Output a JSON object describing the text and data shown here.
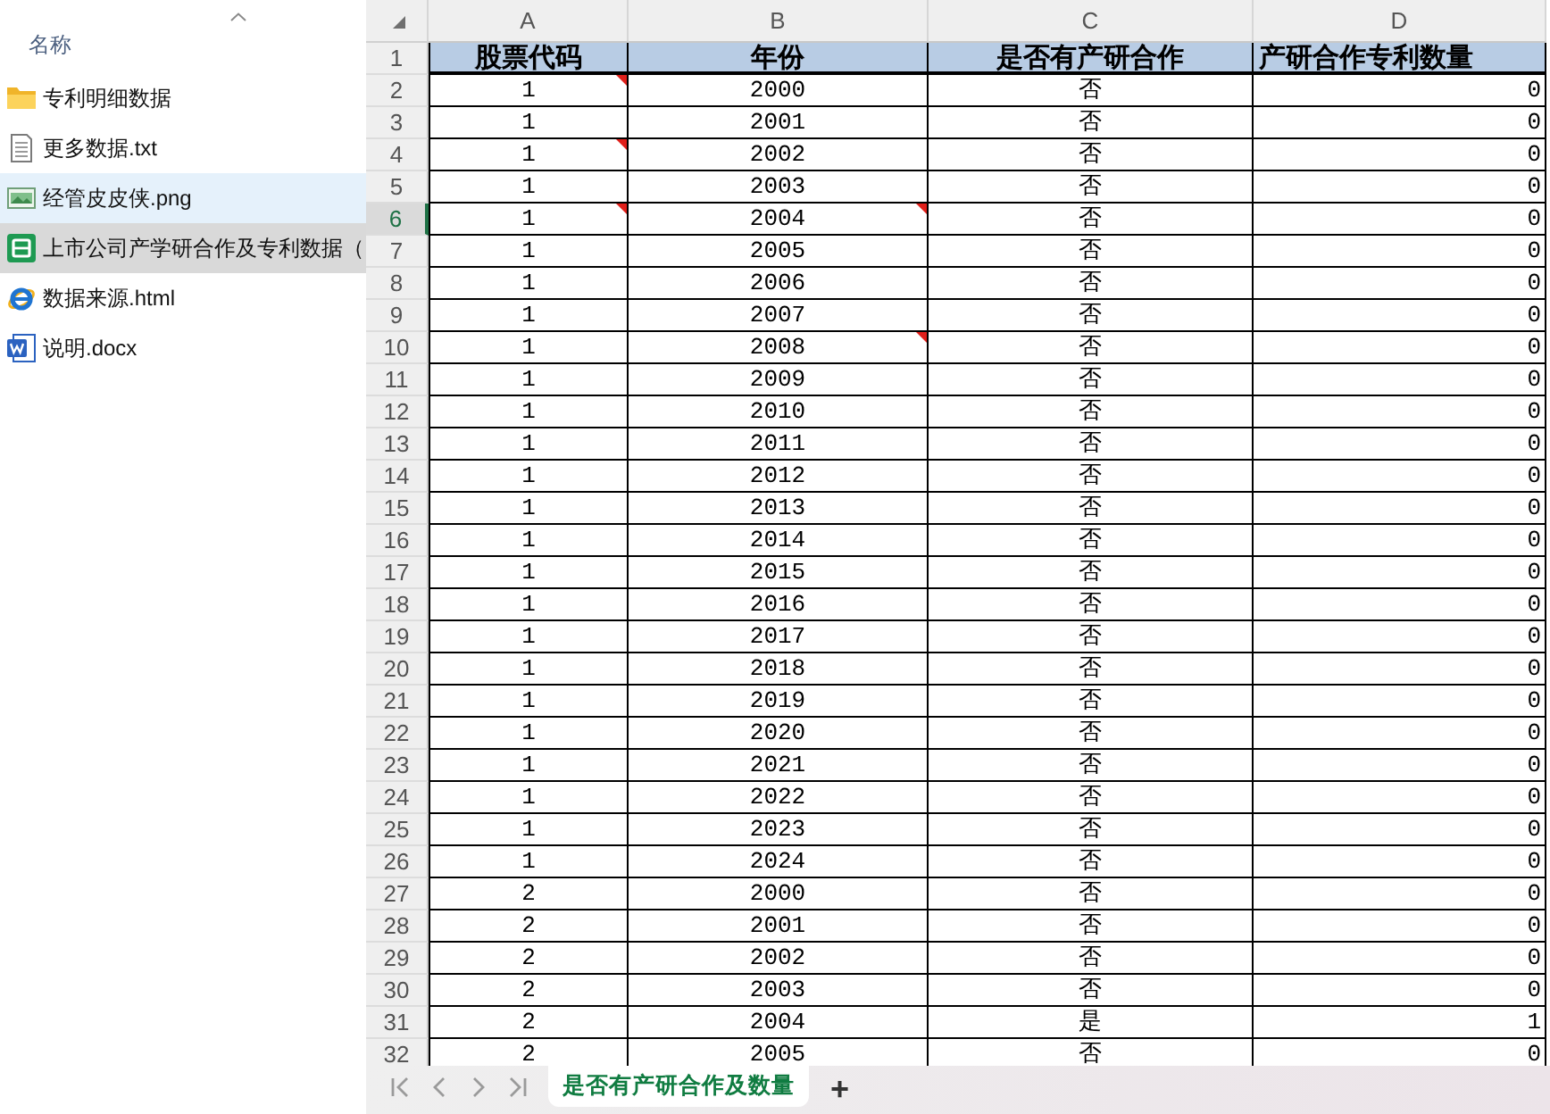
{
  "files_panel": {
    "column_header": "名称",
    "files": [
      {
        "name": "专利明细数据",
        "kind": "folder",
        "hovered": false,
        "selected": false
      },
      {
        "name": "更多数据.txt",
        "kind": "text",
        "hovered": false,
        "selected": false
      },
      {
        "name": "经管皮皮侠.png",
        "kind": "image",
        "hovered": true,
        "selected": false
      },
      {
        "name": "上市公司产学研合作及专利数据（",
        "kind": "spreadsheet",
        "hovered": false,
        "selected": true
      },
      {
        "name": "数据来源.html",
        "kind": "web",
        "hovered": false,
        "selected": false
      },
      {
        "name": "说明.docx",
        "kind": "document",
        "hovered": false,
        "selected": false
      }
    ]
  },
  "sheet": {
    "columns": [
      "A",
      "B",
      "C",
      "D"
    ],
    "header": {
      "number": "1",
      "cells": [
        "股票代码",
        "年份",
        "是否有产研合作",
        "产研合作专利数量"
      ]
    },
    "rows": [
      {
        "number": "2",
        "selected": false,
        "cells": [
          {
            "text": "1",
            "comment": true
          },
          {
            "text": "2000",
            "comment": false
          },
          {
            "text": "否",
            "comment": false
          },
          {
            "text": "0",
            "comment": false
          }
        ]
      },
      {
        "number": "3",
        "selected": false,
        "cells": [
          {
            "text": "1",
            "comment": false
          },
          {
            "text": "2001",
            "comment": false
          },
          {
            "text": "否",
            "comment": false
          },
          {
            "text": "0",
            "comment": false
          }
        ]
      },
      {
        "number": "4",
        "selected": false,
        "cells": [
          {
            "text": "1",
            "comment": true
          },
          {
            "text": "2002",
            "comment": false
          },
          {
            "text": "否",
            "comment": false
          },
          {
            "text": "0",
            "comment": false
          }
        ]
      },
      {
        "number": "5",
        "selected": false,
        "cells": [
          {
            "text": "1",
            "comment": false
          },
          {
            "text": "2003",
            "comment": false
          },
          {
            "text": "否",
            "comment": false
          },
          {
            "text": "0",
            "comment": false
          }
        ]
      },
      {
        "number": "6",
        "selected": true,
        "cells": [
          {
            "text": "1",
            "comment": true
          },
          {
            "text": "2004",
            "comment": true
          },
          {
            "text": "否",
            "comment": false
          },
          {
            "text": "0",
            "comment": false
          }
        ]
      },
      {
        "number": "7",
        "selected": false,
        "cells": [
          {
            "text": "1",
            "comment": false
          },
          {
            "text": "2005",
            "comment": false
          },
          {
            "text": "否",
            "comment": false
          },
          {
            "text": "0",
            "comment": false
          }
        ]
      },
      {
        "number": "8",
        "selected": false,
        "cells": [
          {
            "text": "1",
            "comment": false
          },
          {
            "text": "2006",
            "comment": false
          },
          {
            "text": "否",
            "comment": false
          },
          {
            "text": "0",
            "comment": false
          }
        ]
      },
      {
        "number": "9",
        "selected": false,
        "cells": [
          {
            "text": "1",
            "comment": false
          },
          {
            "text": "2007",
            "comment": false
          },
          {
            "text": "否",
            "comment": false
          },
          {
            "text": "0",
            "comment": false
          }
        ]
      },
      {
        "number": "10",
        "selected": false,
        "cells": [
          {
            "text": "1",
            "comment": false
          },
          {
            "text": "2008",
            "comment": true
          },
          {
            "text": "否",
            "comment": false
          },
          {
            "text": "0",
            "comment": false
          }
        ]
      },
      {
        "number": "11",
        "selected": false,
        "cells": [
          {
            "text": "1",
            "comment": false
          },
          {
            "text": "2009",
            "comment": false
          },
          {
            "text": "否",
            "comment": false
          },
          {
            "text": "0",
            "comment": false
          }
        ]
      },
      {
        "number": "12",
        "selected": false,
        "cells": [
          {
            "text": "1",
            "comment": false
          },
          {
            "text": "2010",
            "comment": false
          },
          {
            "text": "否",
            "comment": false
          },
          {
            "text": "0",
            "comment": false
          }
        ]
      },
      {
        "number": "13",
        "selected": false,
        "cells": [
          {
            "text": "1",
            "comment": false
          },
          {
            "text": "2011",
            "comment": false
          },
          {
            "text": "否",
            "comment": false
          },
          {
            "text": "0",
            "comment": false
          }
        ]
      },
      {
        "number": "14",
        "selected": false,
        "cells": [
          {
            "text": "1",
            "comment": false
          },
          {
            "text": "2012",
            "comment": false
          },
          {
            "text": "否",
            "comment": false
          },
          {
            "text": "0",
            "comment": false
          }
        ]
      },
      {
        "number": "15",
        "selected": false,
        "cells": [
          {
            "text": "1",
            "comment": false
          },
          {
            "text": "2013",
            "comment": false
          },
          {
            "text": "否",
            "comment": false
          },
          {
            "text": "0",
            "comment": false
          }
        ]
      },
      {
        "number": "16",
        "selected": false,
        "cells": [
          {
            "text": "1",
            "comment": false
          },
          {
            "text": "2014",
            "comment": false
          },
          {
            "text": "否",
            "comment": false
          },
          {
            "text": "0",
            "comment": false
          }
        ]
      },
      {
        "number": "17",
        "selected": false,
        "cells": [
          {
            "text": "1",
            "comment": false
          },
          {
            "text": "2015",
            "comment": false
          },
          {
            "text": "否",
            "comment": false
          },
          {
            "text": "0",
            "comment": false
          }
        ]
      },
      {
        "number": "18",
        "selected": false,
        "cells": [
          {
            "text": "1",
            "comment": false
          },
          {
            "text": "2016",
            "comment": false
          },
          {
            "text": "否",
            "comment": false
          },
          {
            "text": "0",
            "comment": false
          }
        ]
      },
      {
        "number": "19",
        "selected": false,
        "cells": [
          {
            "text": "1",
            "comment": false
          },
          {
            "text": "2017",
            "comment": false
          },
          {
            "text": "否",
            "comment": false
          },
          {
            "text": "0",
            "comment": false
          }
        ]
      },
      {
        "number": "20",
        "selected": false,
        "cells": [
          {
            "text": "1",
            "comment": false
          },
          {
            "text": "2018",
            "comment": false
          },
          {
            "text": "否",
            "comment": false
          },
          {
            "text": "0",
            "comment": false
          }
        ]
      },
      {
        "number": "21",
        "selected": false,
        "cells": [
          {
            "text": "1",
            "comment": false
          },
          {
            "text": "2019",
            "comment": false
          },
          {
            "text": "否",
            "comment": false
          },
          {
            "text": "0",
            "comment": false
          }
        ]
      },
      {
        "number": "22",
        "selected": false,
        "cells": [
          {
            "text": "1",
            "comment": false
          },
          {
            "text": "2020",
            "comment": false
          },
          {
            "text": "否",
            "comment": false
          },
          {
            "text": "0",
            "comment": false
          }
        ]
      },
      {
        "number": "23",
        "selected": false,
        "cells": [
          {
            "text": "1",
            "comment": false
          },
          {
            "text": "2021",
            "comment": false
          },
          {
            "text": "否",
            "comment": false
          },
          {
            "text": "0",
            "comment": false
          }
        ]
      },
      {
        "number": "24",
        "selected": false,
        "cells": [
          {
            "text": "1",
            "comment": false
          },
          {
            "text": "2022",
            "comment": false
          },
          {
            "text": "否",
            "comment": false
          },
          {
            "text": "0",
            "comment": false
          }
        ]
      },
      {
        "number": "25",
        "selected": false,
        "cells": [
          {
            "text": "1",
            "comment": false
          },
          {
            "text": "2023",
            "comment": false
          },
          {
            "text": "否",
            "comment": false
          },
          {
            "text": "0",
            "comment": false
          }
        ]
      },
      {
        "number": "26",
        "selected": false,
        "cells": [
          {
            "text": "1",
            "comment": false
          },
          {
            "text": "2024",
            "comment": false
          },
          {
            "text": "否",
            "comment": false
          },
          {
            "text": "0",
            "comment": false
          }
        ]
      },
      {
        "number": "27",
        "selected": false,
        "cells": [
          {
            "text": "2",
            "comment": false
          },
          {
            "text": "2000",
            "comment": false
          },
          {
            "text": "否",
            "comment": false
          },
          {
            "text": "0",
            "comment": false
          }
        ]
      },
      {
        "number": "28",
        "selected": false,
        "cells": [
          {
            "text": "2",
            "comment": false
          },
          {
            "text": "2001",
            "comment": false
          },
          {
            "text": "否",
            "comment": false
          },
          {
            "text": "0",
            "comment": false
          }
        ]
      },
      {
        "number": "29",
        "selected": false,
        "cells": [
          {
            "text": "2",
            "comment": false
          },
          {
            "text": "2002",
            "comment": false
          },
          {
            "text": "否",
            "comment": false
          },
          {
            "text": "0",
            "comment": false
          }
        ]
      },
      {
        "number": "30",
        "selected": false,
        "cells": [
          {
            "text": "2",
            "comment": false
          },
          {
            "text": "2003",
            "comment": false
          },
          {
            "text": "否",
            "comment": false
          },
          {
            "text": "0",
            "comment": false
          }
        ]
      },
      {
        "number": "31",
        "selected": false,
        "cells": [
          {
            "text": "2",
            "comment": false
          },
          {
            "text": "2004",
            "comment": false
          },
          {
            "text": "是",
            "comment": false
          },
          {
            "text": "1",
            "comment": false
          }
        ]
      },
      {
        "number": "32",
        "selected": false,
        "cells": [
          {
            "text": "2",
            "comment": false
          },
          {
            "text": "2005",
            "comment": false
          },
          {
            "text": "否",
            "comment": false
          },
          {
            "text": "0",
            "comment": false
          }
        ]
      }
    ]
  },
  "sheet_tabs": {
    "tabs": [
      {
        "label": "是否有产研合作及数量",
        "selected": true
      }
    ],
    "add_label": "+"
  }
}
